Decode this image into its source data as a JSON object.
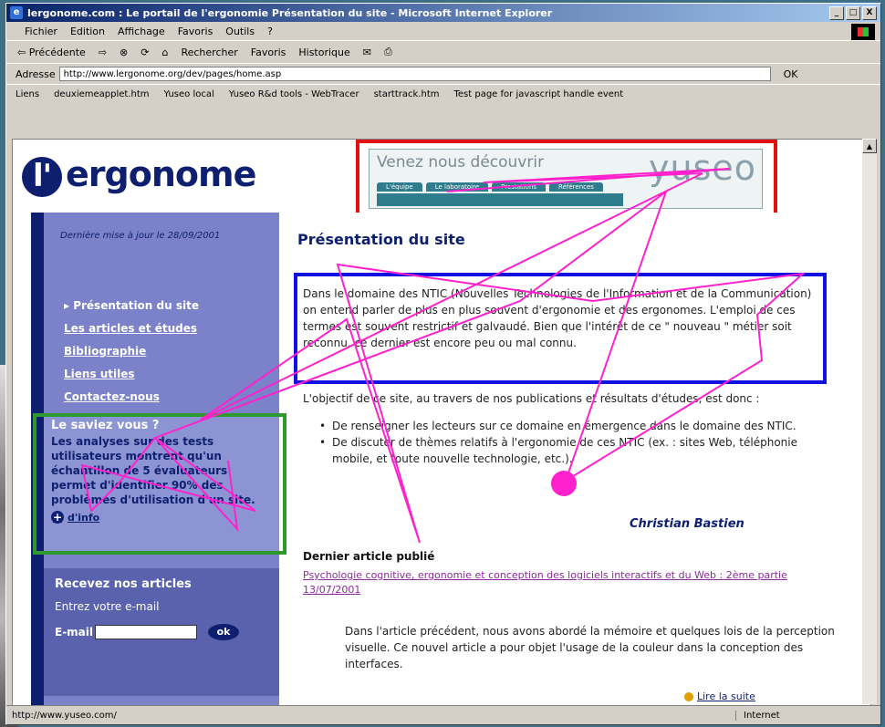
{
  "window": {
    "title": "lergonome.com : Le portail de l'ergonomie Présentation du site - Microsoft Internet Explorer",
    "controls": [
      "_",
      "□",
      "X"
    ]
  },
  "menu": [
    "Fichier",
    "Edition",
    "Affichage",
    "Favoris",
    "Outils",
    "?"
  ],
  "toolbar": {
    "back": "⇦ Précédente",
    "forward": "⇨",
    "search": "Rechercher",
    "favorites": "Favoris",
    "history": "Historique"
  },
  "address": {
    "label": "Adresse",
    "url": "http://www.lergonome.org/dev/pages/home.asp",
    "go": "OK"
  },
  "links": {
    "label": "Liens",
    "items": [
      "deuxiemeapplet.htm",
      "Yuseo local",
      "Yuseo R&d tools - WebTracer",
      "starttrack.htm",
      "Test page for javascript handle event"
    ]
  },
  "page": {
    "logo": "ergonome",
    "banner": {
      "text": "Venez nous découvrir",
      "brand": "yuseo",
      "tabs": [
        "L'équipe",
        "Le laboratoire",
        "Prestations",
        "Références"
      ]
    },
    "last_update": "Dernière mise à jour le 28/09/2001",
    "nav": [
      "▸ Présentation du site",
      "Les articles et études",
      "Bibliographie",
      "Liens utiles",
      "Contactez-nous"
    ],
    "saviez": {
      "title": "Le saviez vous ?",
      "body": "Les analyses sur des tests utilisateurs montrent qu'un échantillon de 5 évaluateurs permet d'identifier 90% des problèmes d'utilisation d'un site.",
      "more": "d'info"
    },
    "recevez": {
      "title": "Recevez nos articles",
      "prompt": "Entrez votre e-mail",
      "email_label": "E-mail",
      "ok": "ok"
    },
    "heading": "Présentation du site",
    "para1": "Dans le domaine des NTIC (Nouvelles Technologies de l'Information et de la Communication) on entend parler de plus en plus souvent d'ergonomie et des ergonomes. L'emploi de ces termes est souvent restrictif et galvaudé. Bien que l'intérêt de ce \" nouveau \" métier soit reconnu, ce dernier est encore peu ou mal connu.",
    "para2": "L'objectif de ce site, au travers de nos publications et résultats d'études, est donc :",
    "bullets": [
      "De renseigner les lecteurs sur ce domaine en émergence dans le domaine des NTIC.",
      "De discuter de thèmes relatifs à l'ergonomie de ces NTIC (ex. : sites Web, téléphonie mobile, et toute nouvelle technologie, etc.)."
    ],
    "author": "Christian Bastien",
    "last_article_label": "Dernier article publié",
    "last_article_link": "Psychologie cognitive, ergonomie et conception des logiciels interactifs et du Web : 2ème partie 13/07/2001",
    "para3": "Dans l'article précédent, nous avons abordé la mémoire et quelques lois de la perception visuelle. Ce nouvel article a pour objet l'usage de la couleur dans la conception des interfaces.",
    "read_more": "Lire la suite"
  },
  "status": {
    "url": "http://www.yuseo.com/",
    "zone": "Internet"
  }
}
